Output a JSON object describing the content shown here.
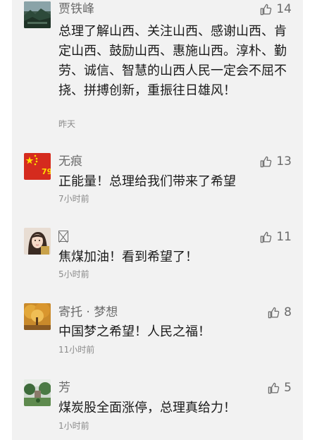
{
  "comments": [
    {
      "user": "贾铁峰",
      "likes": "14",
      "text": "总理了解山西、关注山西、感谢山西、肯定山西、鼓励山西、惠施山西。淳朴、勤劳、诚信、智慧的山西人民一定会不屈不挠、拼搏创新，重振往日雄风！",
      "time": "昨天",
      "avatar_icon": "landscape-avatar-icon"
    },
    {
      "user": "无痕",
      "likes": "13",
      "text": "正能量！总理给我们带来了希望",
      "time": "7小时前",
      "avatar_icon": "flag-avatar-icon"
    },
    {
      "user": "",
      "likes": "11",
      "text": "焦煤加油！看到希望了！",
      "time": "5小时前",
      "avatar_icon": "portrait-avatar-icon"
    },
    {
      "user": "寄托 · 梦想",
      "likes": "8",
      "text": "中国梦之希望！人民之福！",
      "time": "11小时前",
      "avatar_icon": "autumn-tree-avatar-icon"
    },
    {
      "user": "芳",
      "likes": "5",
      "text": "煤炭股全面涨停，总理真给力！",
      "time": "1小时前",
      "avatar_icon": "garden-avatar-icon"
    }
  ],
  "colors": {
    "panel_bg": "#f2f2f2",
    "text": "#1a1a1a",
    "meta": "#8a8a8a",
    "flag_red": "#d52b1e",
    "flag_yellow": "#ffde00"
  }
}
